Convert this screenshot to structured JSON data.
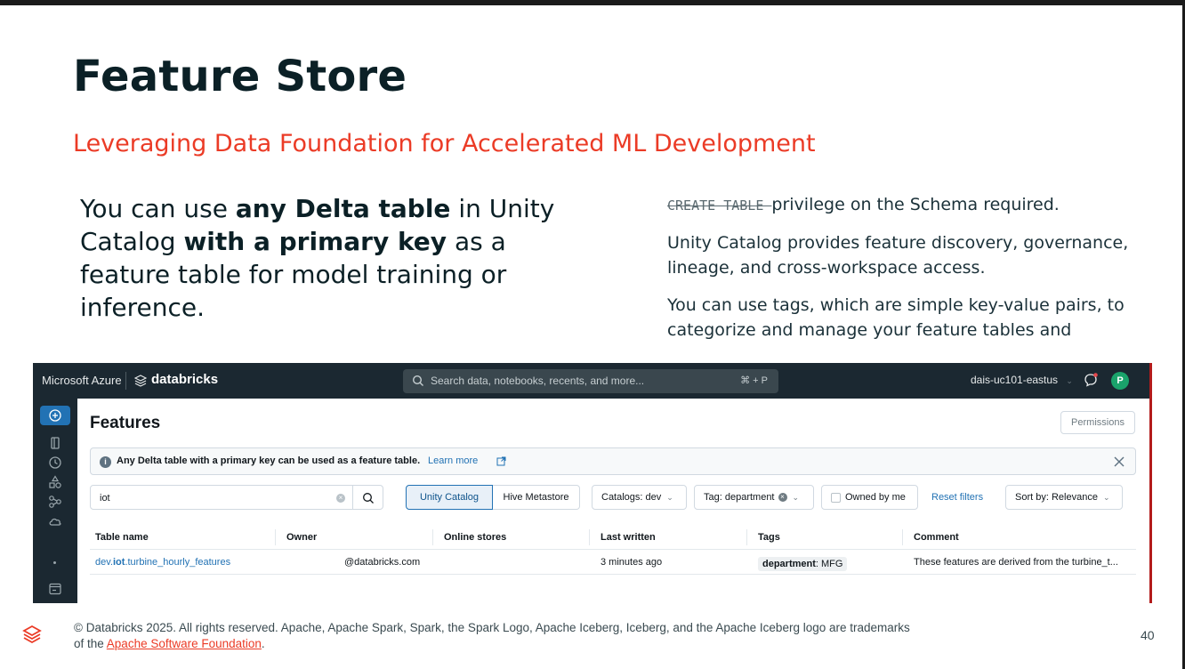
{
  "slide": {
    "title": "Feature Store",
    "subtitle": "Leveraging Data Foundation for Accelerated ML Development",
    "left": {
      "t1": "You can use ",
      "b1": "any Delta table",
      "t2": " in Unity Catalog ",
      "b2": "with a primary key",
      "t3": " as a feature table for model training or inference."
    },
    "right": {
      "p1_code": "CREATE TABLE ",
      "p1_text": "privilege on the Schema required.",
      "p2": "Unity Catalog provides feature discovery, governance, lineage, and cross-workspace access.",
      "p3": "You can use tags, which are simple key-value pairs, to categorize and manage your feature tables and"
    },
    "footer": {
      "text": "© Databricks 2025. All rights reserved. Apache, Apache Spark, Spark, the Spark Logo, Apache Iceberg, Iceberg, and the Apache Iceberg logo are trademarks of the ",
      "link": "Apache Software Foundation",
      "end": "."
    },
    "page_number": "40"
  },
  "app": {
    "brand": "Microsoft Azure",
    "product": "databricks",
    "search_placeholder": "Search data, notebooks, recents, and more...",
    "search_shortcut": "⌘ + P",
    "workspace": "dais-uc101-eastus",
    "avatar_initial": "P",
    "page_title": "Features",
    "permissions_label": "Permissions",
    "banner_text": "Any Delta table with a primary key can be used as a feature table.",
    "banner_link": "Learn more",
    "search_value": "iot",
    "seg_uc": "Unity Catalog",
    "seg_hive": "Hive Metastore",
    "catalogs_filter": "Catalogs: dev",
    "tag_filter": "Tag: department",
    "owned_by_me": "Owned by me",
    "reset_filters": "Reset filters",
    "sort_by": "Sort by: Relevance",
    "columns": [
      "Table name",
      "Owner",
      "Online stores",
      "Last written",
      "Tags",
      "Comment"
    ],
    "row": {
      "name_prefix": "dev.",
      "name_bold": "iot",
      "name_suffix": ".turbine_hourly_features",
      "owner": "@databricks.com",
      "online_stores": "",
      "last_written": "3 minutes ago",
      "tag_key": "department",
      "tag_value": ": MFG",
      "comment": "These features are derived from the turbine_t..."
    }
  },
  "colors": {
    "accent_red": "#eb3b26",
    "navy": "#0b2026",
    "link_blue": "#2272b4",
    "topbar": "#1b2831"
  }
}
